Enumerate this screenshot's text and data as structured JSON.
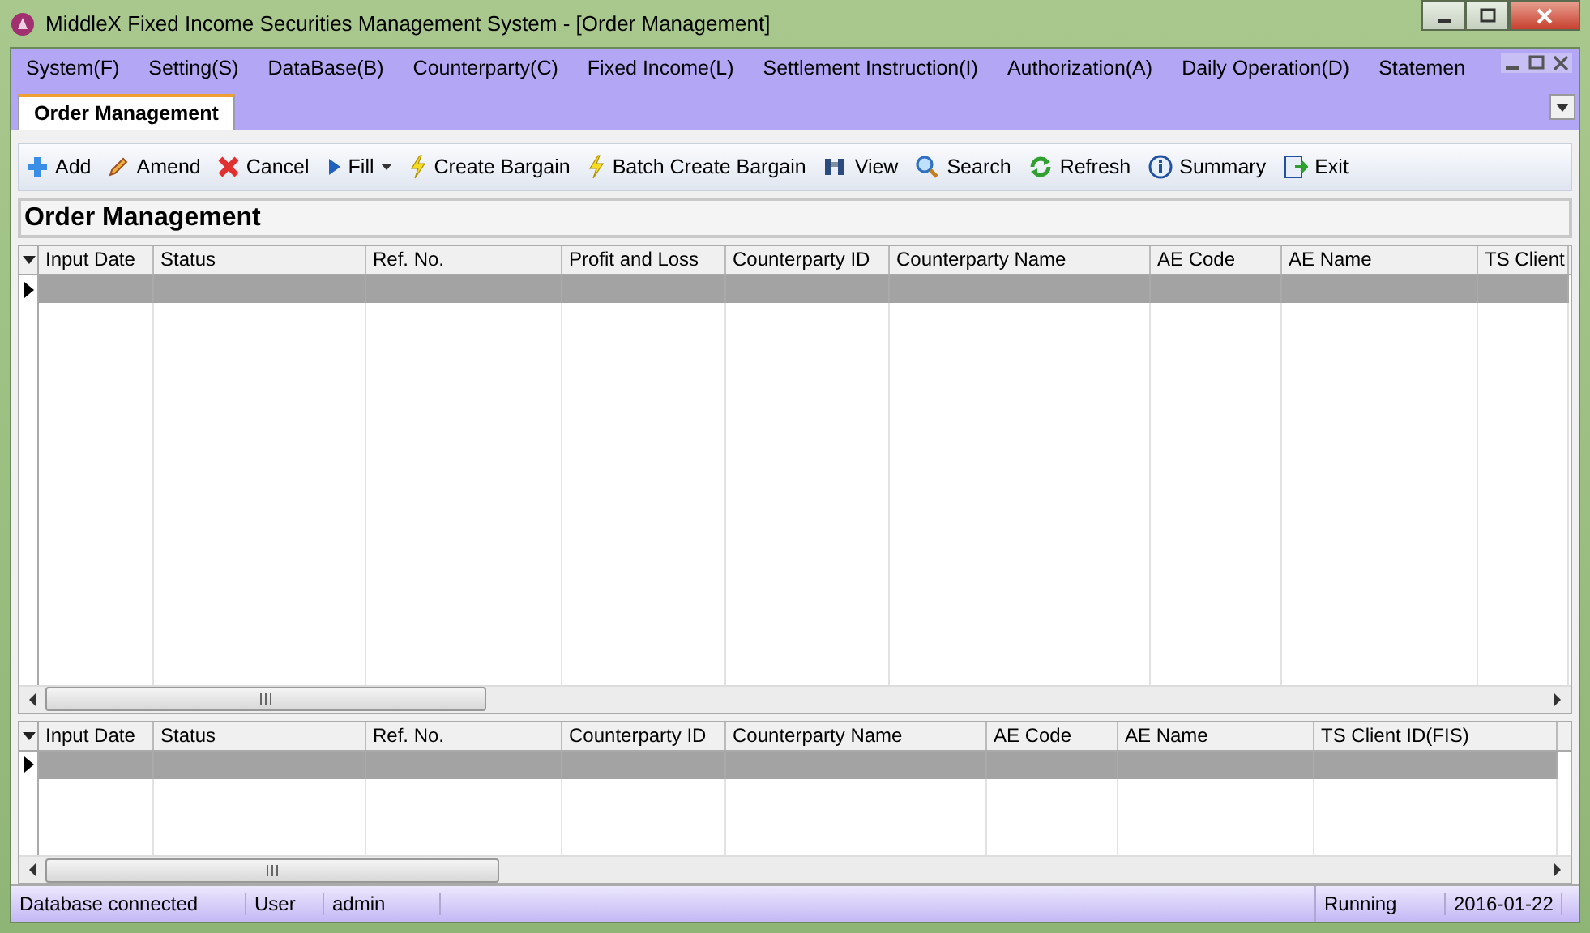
{
  "window": {
    "title": "MiddleX Fixed Income Securities Management System - [Order Management]"
  },
  "menu": [
    "System(F)",
    "Setting(S)",
    "DataBase(B)",
    "Counterparty(C)",
    "Fixed Income(L)",
    "Settlement Instruction(I)",
    "Authorization(A)",
    "Daily Operation(D)",
    "Statemen"
  ],
  "tabs": [
    {
      "label": "Order Management",
      "selected": true
    }
  ],
  "toolbar": [
    {
      "kind": "add",
      "label": "Add"
    },
    {
      "kind": "amend",
      "label": "Amend"
    },
    {
      "kind": "cancel",
      "label": "Cancel"
    },
    {
      "kind": "fill",
      "label": "Fill"
    },
    {
      "kind": "bolt",
      "label": "Create Bargain"
    },
    {
      "kind": "bolt",
      "label": "Batch Create Bargain"
    },
    {
      "kind": "view",
      "label": "View"
    },
    {
      "kind": "search",
      "label": "Search"
    },
    {
      "kind": "refresh",
      "label": "Refresh"
    },
    {
      "kind": "info",
      "label": "Summary"
    },
    {
      "kind": "exit",
      "label": "Exit"
    }
  ],
  "panel": {
    "title": "Order Management"
  },
  "grids": [
    {
      "columns": [
        "Input Date",
        "Status",
        "Ref. No.",
        "Profit and Loss",
        "Counterparty ID",
        "Counterparty Name",
        "AE Code",
        "AE Name",
        "TS Client"
      ]
    },
    {
      "columns": [
        "Input Date",
        "Status",
        "Ref. No.",
        "Counterparty ID",
        "Counterparty Name",
        "AE Code",
        "AE Name",
        "TS Client ID(FIS)"
      ]
    }
  ],
  "status_bar": [
    "Database connected",
    "User",
    "admin",
    "Running",
    "2016-01-22"
  ]
}
